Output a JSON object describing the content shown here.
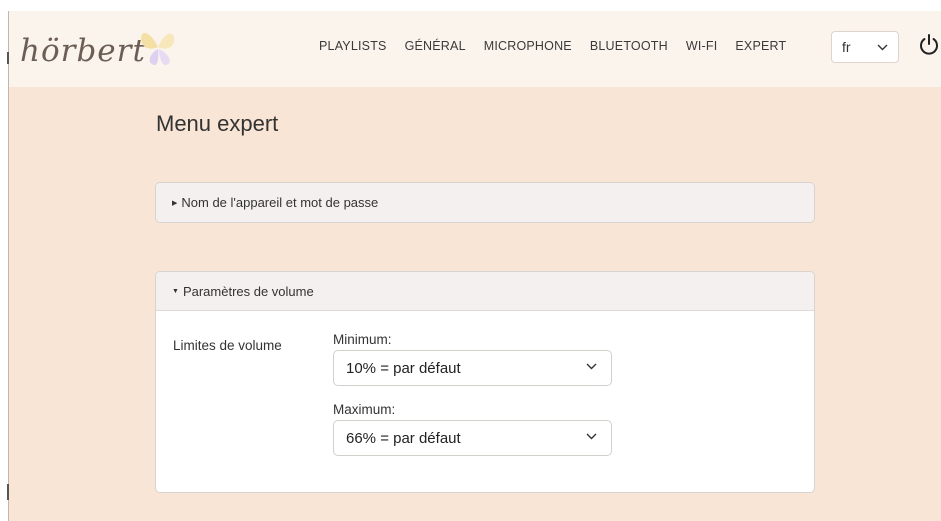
{
  "brand": {
    "name": "hörbert"
  },
  "nav": {
    "links": [
      "PLAYLISTS",
      "GÉNÉRAL",
      "MICROPHONE",
      "BLUETOOTH",
      "WI-FI",
      "EXPERT"
    ],
    "language": "fr"
  },
  "page": {
    "title": "Menu expert"
  },
  "panels": {
    "device": {
      "title": "Nom de l'appareil et mot de passe",
      "expanded": false
    },
    "volume": {
      "title": "Paramètres de volume",
      "expanded": true,
      "row_label": "Limites de volume",
      "minimum_label": "Minimum:",
      "minimum_value": "10% = par défaut",
      "maximum_label": "Maximum:",
      "maximum_value": "66% = par défaut"
    }
  },
  "icons": {
    "power": "power-icon",
    "chevron": "chevron-down-icon",
    "caret_right": "caret-right-icon",
    "caret_down": "caret-down-icon",
    "butterfly": "butterfly-logo"
  },
  "colors": {
    "page_background": "#f8e5d5",
    "navbar_background": "#fbf4ed",
    "panel_header_background": "#f4f0ef",
    "logo_text": "#6b5e55",
    "butterfly_yellow": "#f3dd9c",
    "butterfly_lilac": "#d8cdef"
  }
}
